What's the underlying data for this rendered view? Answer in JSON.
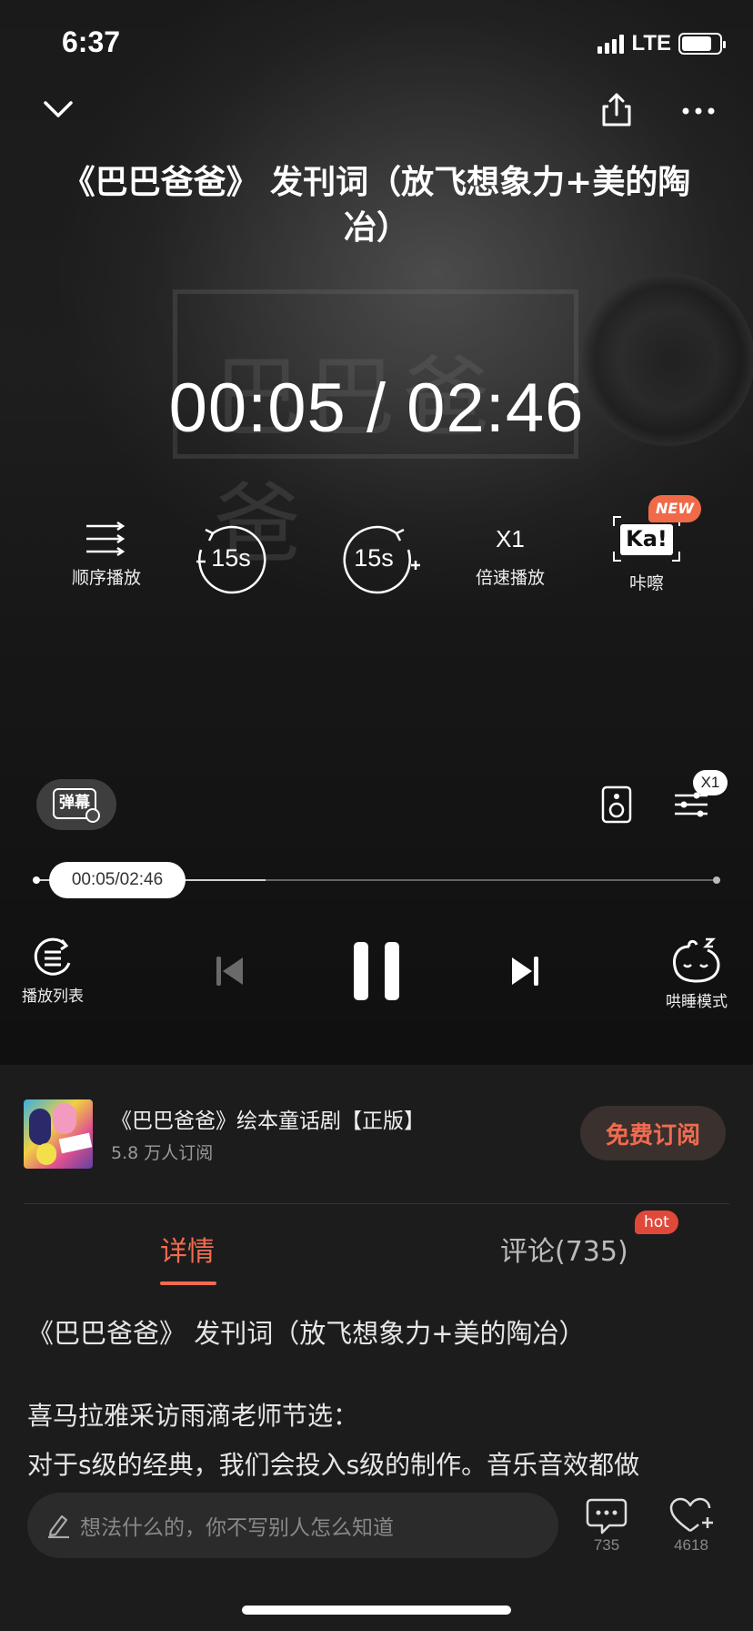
{
  "status_bar": {
    "time": "6:37",
    "network": "LTE",
    "battery_level": 0.8
  },
  "header": {
    "collapse_icon": "chevron-down-icon",
    "share_icon": "share-icon",
    "more_icon": "more-dots-icon"
  },
  "track": {
    "title": "《巴巴爸爸》 发刊词（放飞想象力+美的陶冶）",
    "elapsed": "00:05",
    "duration": "02:46",
    "timer_display": "00:05  /  02:46",
    "progress_label": "00:05/02:46",
    "progress_fraction": 0.03,
    "buffered_fraction": 0.33
  },
  "controls": {
    "play_order": {
      "label": "顺序播放",
      "icon": "sequential-play-icon"
    },
    "rewind": {
      "label": "15s",
      "icon": "rewind-15-icon"
    },
    "forward": {
      "label": "15s",
      "icon": "forward-15-icon"
    },
    "speed": {
      "value": "X1",
      "label": "倍速播放"
    },
    "kacha": {
      "label": "咔嚓",
      "badge": "NEW",
      "icon_text": "Ka!"
    }
  },
  "mid_toolbar": {
    "danmu_label": "弹幕",
    "speaker_icon": "speaker-icon",
    "equalizer_icon": "equalizer-icon",
    "equalizer_badge": "X1"
  },
  "bottom_controls": {
    "playlist_label": "播放列表",
    "sleep_label": "哄睡模式",
    "prev_icon": "previous-track-icon",
    "pause_icon": "pause-icon",
    "next_icon": "next-track-icon"
  },
  "album": {
    "title": "《巴巴爸爸》绘本童话剧【正版】",
    "subscribers": "5.8 万人订阅",
    "subscribe_label": "免费订阅"
  },
  "tabs": {
    "details": "详情",
    "comments": "评论(735)",
    "hot_badge": "hot"
  },
  "description": {
    "title": "《巴巴爸爸》 发刊词（放飞想象力+美的陶冶）",
    "line1": "喜马拉雅采访雨滴老师节选：",
    "line2": "对于s级的经典，我们会投入s级的制作。音乐音效都做"
  },
  "footer": {
    "comment_placeholder": "想法什么的，你不写别人怎么知道",
    "comment_count": "735",
    "like_count": "4618"
  },
  "colors": {
    "accent": "#f26b50",
    "hot": "#e0483a",
    "new_badge": "#f06a4a"
  }
}
